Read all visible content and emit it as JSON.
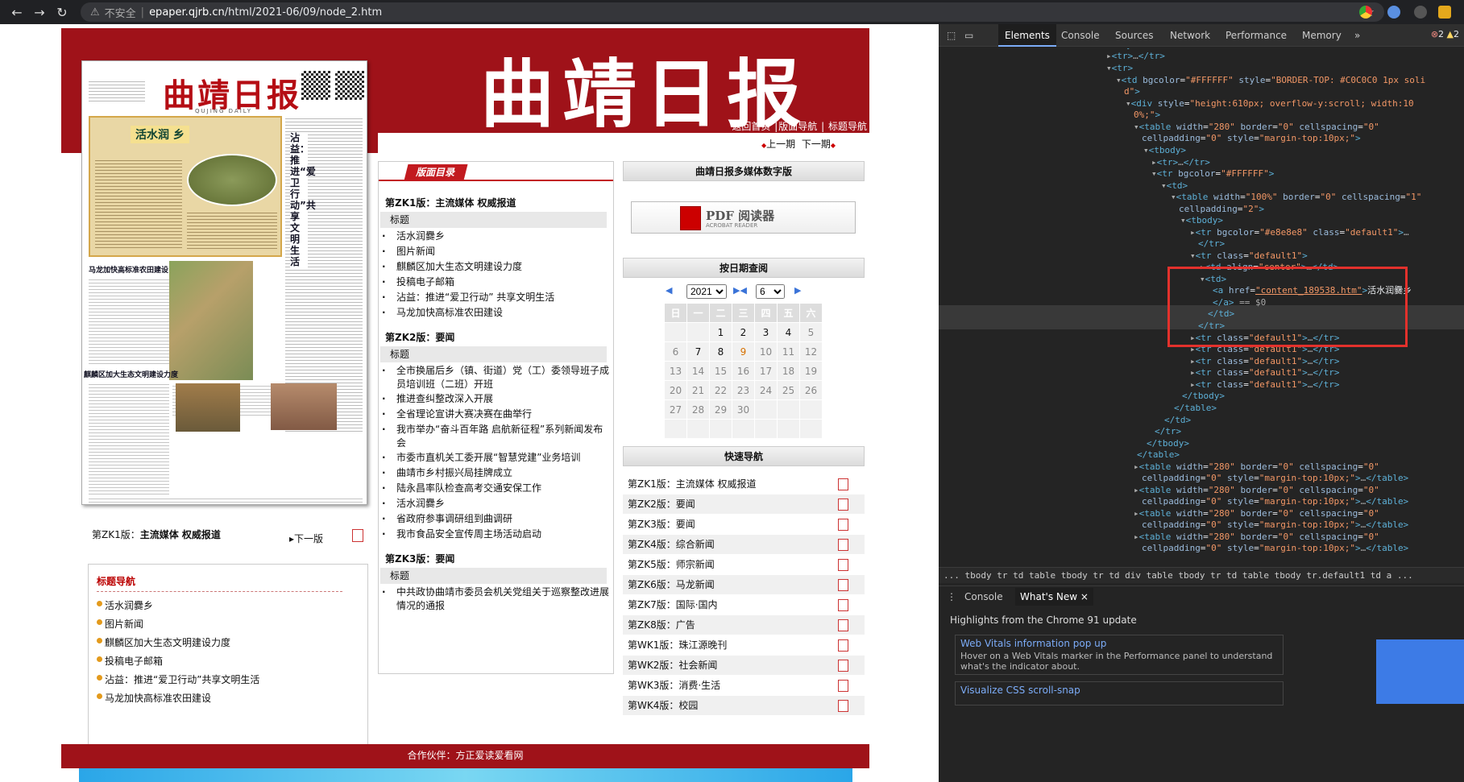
{
  "browser": {
    "insecure_label": "不安全",
    "url_host": "epaper.qjrb.cn",
    "url_path": "/html/2021-06/09/node_2.htm"
  },
  "masthead": {
    "title": "曲靖日报",
    "links": [
      "返回首页",
      "版面导航",
      "标题导航"
    ],
    "prev": "上一期",
    "next": "下一期"
  },
  "thumbnail": {
    "paper_title": "曲靖日报",
    "paper_sub": "QUJING DAILY",
    "headline": "活水润 乡",
    "side_headline": "沾益：推进“爱卫行动” 共享文明生活",
    "mid_headline1": "马龙加快高标准农田建设",
    "mid_headline2": "麒麟区加大生态文明建设力度"
  },
  "page_nav": {
    "current_prefix": "第ZK1版：",
    "current_name": "主流媒体 权威报道",
    "next": "下一版"
  },
  "title_nav": {
    "heading": "标题导航",
    "items": [
      "活水润爨乡",
      "图片新闻",
      "麒麟区加大生态文明建设力度",
      "投稿电子邮箱",
      "沾益：推进“爱卫行动”共享文明生活",
      "马龙加快高标准农田建设"
    ]
  },
  "toc": {
    "tab": "版面目录",
    "col_header": "标题",
    "sections": [
      {
        "name": "第ZK1版：主流媒体 权威报道",
        "items": [
          "活水润爨乡",
          "图片新闻",
          "麒麟区加大生态文明建设力度",
          "投稿电子邮箱",
          "沾益：推进“爱卫行动” 共享文明生活",
          "马龙加快高标准农田建设"
        ]
      },
      {
        "name": "第ZK2版：要闻",
        "items": [
          "全市换届后乡（镇、街道）党（工）委领导班子成员培训班（二班）开班",
          "推进查纠整改深入开展",
          "全省理论宣讲大赛决赛在曲举行",
          "我市举办“奋斗百年路 启航新征程”系列新闻发布会",
          "市委市直机关工委开展“智慧党建”业务培训",
          "曲靖市乡村振兴局挂牌成立",
          "陆永昌率队检查高考交通安保工作",
          "活水润爨乡",
          "省政府参事调研组到曲调研",
          "我市食品安全宣传周主场活动启动"
        ]
      },
      {
        "name": "第ZK3版：要闻",
        "items": [
          "中共政协曲靖市委员会机关党组关于巡察整改进展情况的通报"
        ]
      }
    ]
  },
  "right": {
    "digital_head": "曲靖日报多媒体数字版",
    "pdf_label": "PDF 阅读器",
    "pdf_sub": "ACROBAT READER",
    "date_head": "按日期查阅",
    "year": "2021",
    "month": "6",
    "weekdays": [
      "日",
      "一",
      "二",
      "三",
      "四",
      "五",
      "六"
    ],
    "weeks": [
      [
        "",
        "",
        "1",
        "2",
        "3",
        "4",
        "5"
      ],
      [
        "6",
        "7",
        "8",
        "9",
        "10",
        "11",
        "12"
      ],
      [
        "13",
        "14",
        "15",
        "16",
        "17",
        "18",
        "19"
      ],
      [
        "20",
        "21",
        "22",
        "23",
        "24",
        "25",
        "26"
      ],
      [
        "27",
        "28",
        "29",
        "30",
        "",
        "",
        ""
      ],
      [
        "",
        "",
        "",
        "",
        "",
        "",
        ""
      ]
    ],
    "quick_head": "快速导航",
    "quick": [
      "第ZK1版：主流媒体 权威报道",
      "第ZK2版：要闻",
      "第ZK3版：要闻",
      "第ZK4版：综合新闻",
      "第ZK5版：师宗新闻",
      "第ZK6版：马龙新闻",
      "第ZK7版：国际·国内",
      "第ZK8版：广告",
      "第WK1版：珠江源晚刊",
      "第WK2版：社会新闻",
      "第WK3版：消费·生活",
      "第WK4版：校园"
    ]
  },
  "footer": "合作伙伴：方正爱读爱看网",
  "devtools": {
    "tabs": [
      "Elements",
      "Console",
      "Sources",
      "Network",
      "Performance",
      "Memory"
    ],
    "errors": "2",
    "warnings": "2",
    "breadcrumbs": "... tbody  tr  td  table  tbody  tr  td  div  table  tbody  tr  td  table  tbody  tr.default1  td  a ...",
    "drawer_tabs": [
      "Console",
      "What's New"
    ],
    "highlights": "Highlights from the Chrome 91 update",
    "cards": [
      {
        "title": "Web Vitals information pop up",
        "desc": "Hover on a Web Vitals marker in the Performance panel to understand what's the indicator about."
      },
      {
        "title": "Visualize CSS scroll-snap",
        "desc": ""
      }
    ]
  }
}
